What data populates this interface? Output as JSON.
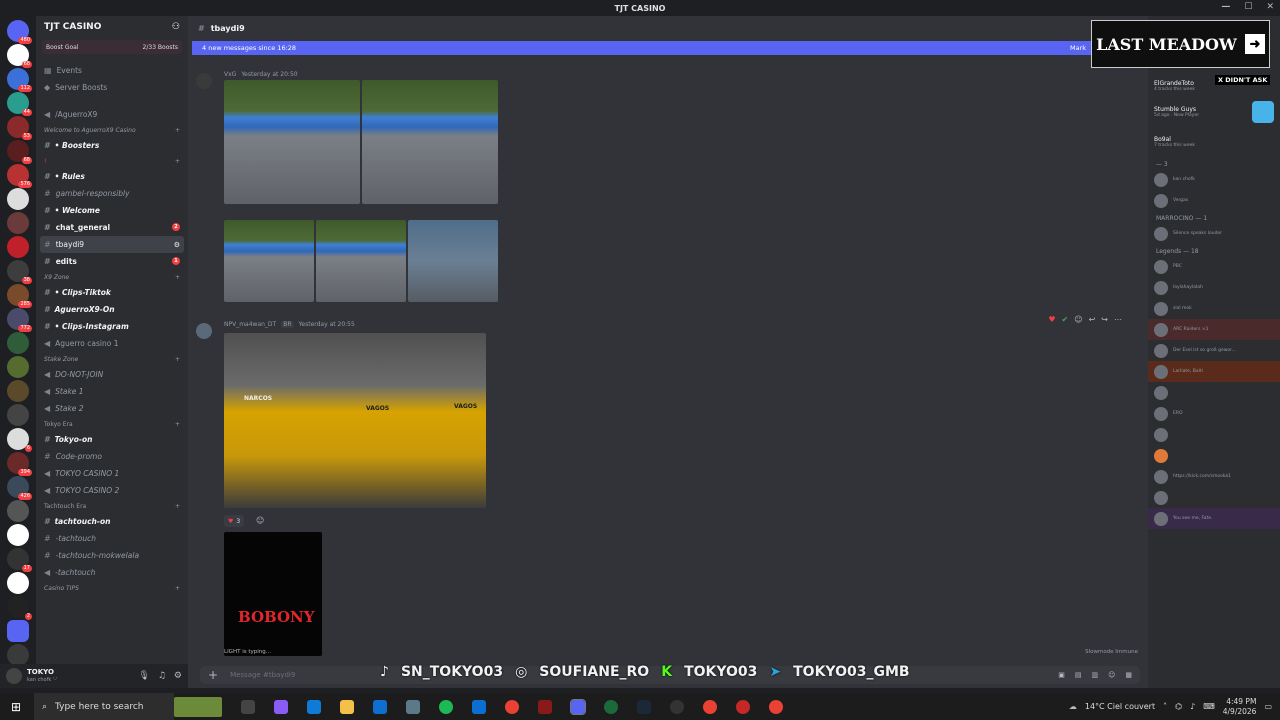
{
  "window": {
    "title": "TJT CASINO"
  },
  "server": {
    "name": "TJT CASINO",
    "boost_label": "Boost Goal",
    "boost_count": "2/33 Boosts"
  },
  "sidebar": {
    "top_items": [
      {
        "label": "Events"
      },
      {
        "label": "Server Boosts"
      },
      {
        "label": "/AguerroX9"
      }
    ],
    "categories": [
      {
        "label": "Welcome to AguerroX9 Casino"
      },
      {
        "label": "X9 Zone"
      },
      {
        "label": "Stake Zone"
      },
      {
        "label": "Tokyo Era"
      },
      {
        "label": "Tachtouch Era"
      },
      {
        "label": "Casino TIPS"
      }
    ],
    "channels": [
      {
        "label": "• Boosters"
      },
      {
        "label": "• Rules"
      },
      {
        "label": "gambel-responsibly"
      },
      {
        "label": "• Welcome"
      },
      {
        "label": "chat_general",
        "badge": "2"
      },
      {
        "label": "tbaydi9"
      },
      {
        "label": "edits",
        "badge": "1"
      },
      {
        "label": "• Clips-Tiktok"
      },
      {
        "label": "AguerroX9-On"
      },
      {
        "label": "• Clips-Instagram"
      },
      {
        "label": "Aguerro casino 1"
      },
      {
        "label": "DO-NOT-JOIN"
      },
      {
        "label": "Stake 1"
      },
      {
        "label": "Stake 2"
      },
      {
        "label": "Tokyo-on"
      },
      {
        "label": "Code-promo"
      },
      {
        "label": "TOKYO CASINO 1"
      },
      {
        "label": "TOKYO CASINO 2"
      },
      {
        "label": "tachtouch-on"
      },
      {
        "label": "-tachtouch"
      },
      {
        "label": "-tachtouch-mokwelala"
      },
      {
        "label": "-tachtouch"
      }
    ]
  },
  "user": {
    "name": "TOKYO",
    "status": "kan chofk '-'"
  },
  "channel": {
    "name": "tbaydi9",
    "new_messages": "4 new messages since 16:28",
    "mark": "Mark"
  },
  "messages": [
    {
      "author": "VxG",
      "time": "Yesterday at 20:50"
    },
    {
      "author": "NPV_ma4wan_DT",
      "tag": "BR",
      "time": "Yesterday at 20:55",
      "reactions": "3"
    }
  ],
  "photo_text": [
    "NARCOS",
    "VAGOS",
    "VAGOS"
  ],
  "clip_text": "BOBONY",
  "typing": "LIGHT is typing...",
  "slowmode": "Slowmode Immune",
  "composer": {
    "placeholder": "Message #tbaydi9"
  },
  "overlay_socials": [
    "SN_TOKYO03",
    "SOUFIANE_RO",
    "TOKYO03",
    "TOKYO03_GMB"
  ],
  "stream_overlay": {
    "title": "LAST MEADOW",
    "caption": "X DIDN'T ASK"
  },
  "members": {
    "entries": [
      {
        "name": "ElGrandeToto",
        "status": "4 tracks this week"
      },
      {
        "name": "Stumble Guys",
        "status": "5d ago · New Player"
      },
      {
        "name": "Bo9al",
        "status": "7 tracks this week"
      }
    ],
    "group1": "— 3",
    "group2": "MARROCINO — 1",
    "group3": "Legends — 18",
    "others": [
      {
        "status": "kan chofk"
      },
      {
        "status": "Vergas"
      },
      {
        "status": "Silence speaks louder"
      },
      {
        "status": "PBC"
      },
      {
        "status": "laylahaylalah"
      },
      {
        "status": "slal mok"
      },
      {
        "status": "ARC Raiders ×1"
      },
      {
        "status": "Der Esel ist so groß gewor..."
      },
      {
        "status": "Larliate, Balti"
      },
      {
        "status": "ERO"
      },
      {
        "status": "https://kick.com/smooka1"
      },
      {
        "status": "You see me, Fate."
      }
    ]
  },
  "taskbar": {
    "search_placeholder": "Type here to search",
    "weather": "14°C  Ciel couvert",
    "time": "4:49 PM",
    "date": "4/9/2026"
  }
}
